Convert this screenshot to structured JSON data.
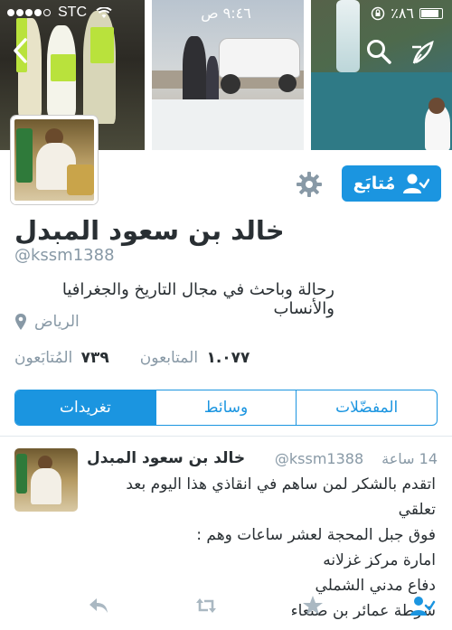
{
  "status_bar": {
    "carrier": "STC",
    "time": "٩:٤٦ ص",
    "battery_percent": "٪٨٦",
    "signal_bars_filled": 4,
    "signal_bars_total": 5
  },
  "header": {
    "back_icon": "chevron-left-icon",
    "search_icon": "search-icon",
    "compose_icon": "compose-icon"
  },
  "profile": {
    "name": "خالد بن سعود المبدل",
    "handle": "@kssm1388",
    "bio": "رحالة وباحث في مجال التاريخ والجغرافيا والأنساب",
    "location": "الرياض",
    "followers_label": "المتابعون",
    "followers_count": "١.٠٧٧",
    "following_label": "المُتابَعون",
    "following_count": "٧٣٩",
    "follow_button_label": "مُتابَع",
    "accent_color": "#1b95e0"
  },
  "tabs": [
    {
      "label": "تغريدات",
      "active": true
    },
    {
      "label": "وسائط",
      "active": false
    },
    {
      "label": "المفضّلات",
      "active": false
    }
  ],
  "tweet": {
    "name": "خالد بن سعود المبدل",
    "handle": "@kssm1388",
    "time": "14 ساعة",
    "text": "اتقدم بالشكر لمن ساهم في انقاذي هذا اليوم بعد تعلقي\nفوق جبل المحجة لعشر ساعات وهم  :\nامارة مركز غزلانه\nدفاع مدني الشملي\nشرطة عمائر بن صنعاء",
    "actions": [
      "reply-icon",
      "retweet-icon",
      "favorite-icon",
      "follow-icon"
    ]
  }
}
